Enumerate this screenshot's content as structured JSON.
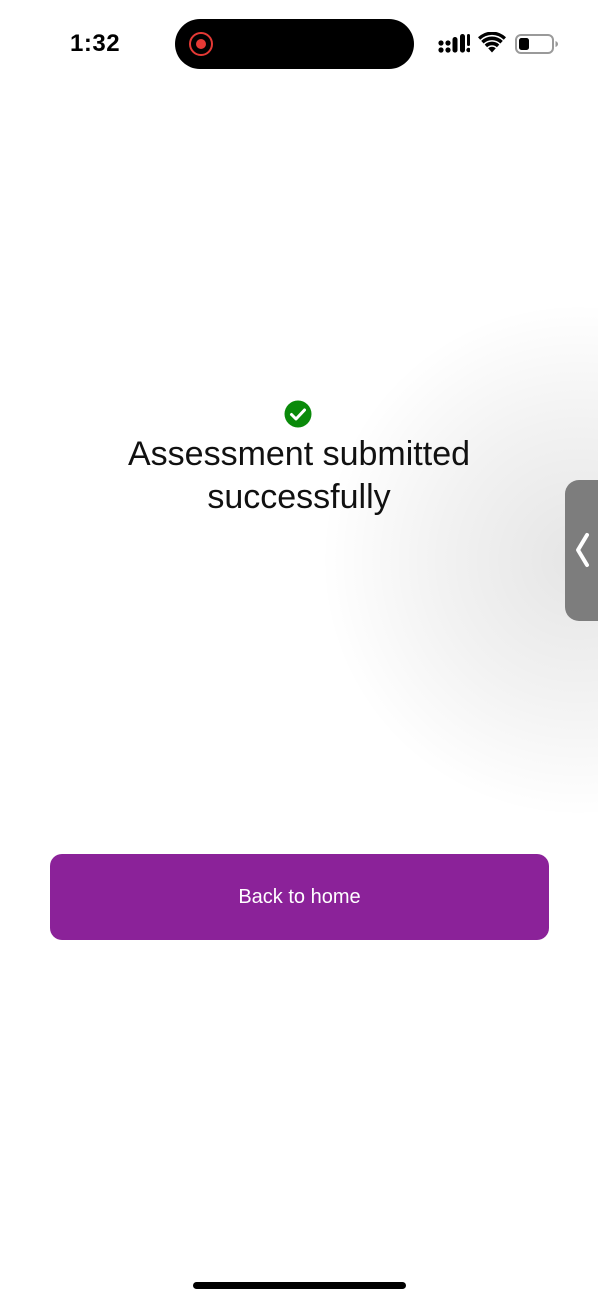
{
  "status_bar": {
    "time": "1:32",
    "recording_color": "#e53935",
    "icons": [
      "signal-icon",
      "wifi-icon",
      "battery-icon"
    ]
  },
  "main": {
    "success_icon": "check-circle-icon",
    "success_color": "#0a8a0a",
    "message": "Assessment submitted successfully",
    "button_label": "Back to home",
    "button_color": "#8b2299"
  },
  "side_handle": {
    "icon": "chevron-left-icon"
  }
}
